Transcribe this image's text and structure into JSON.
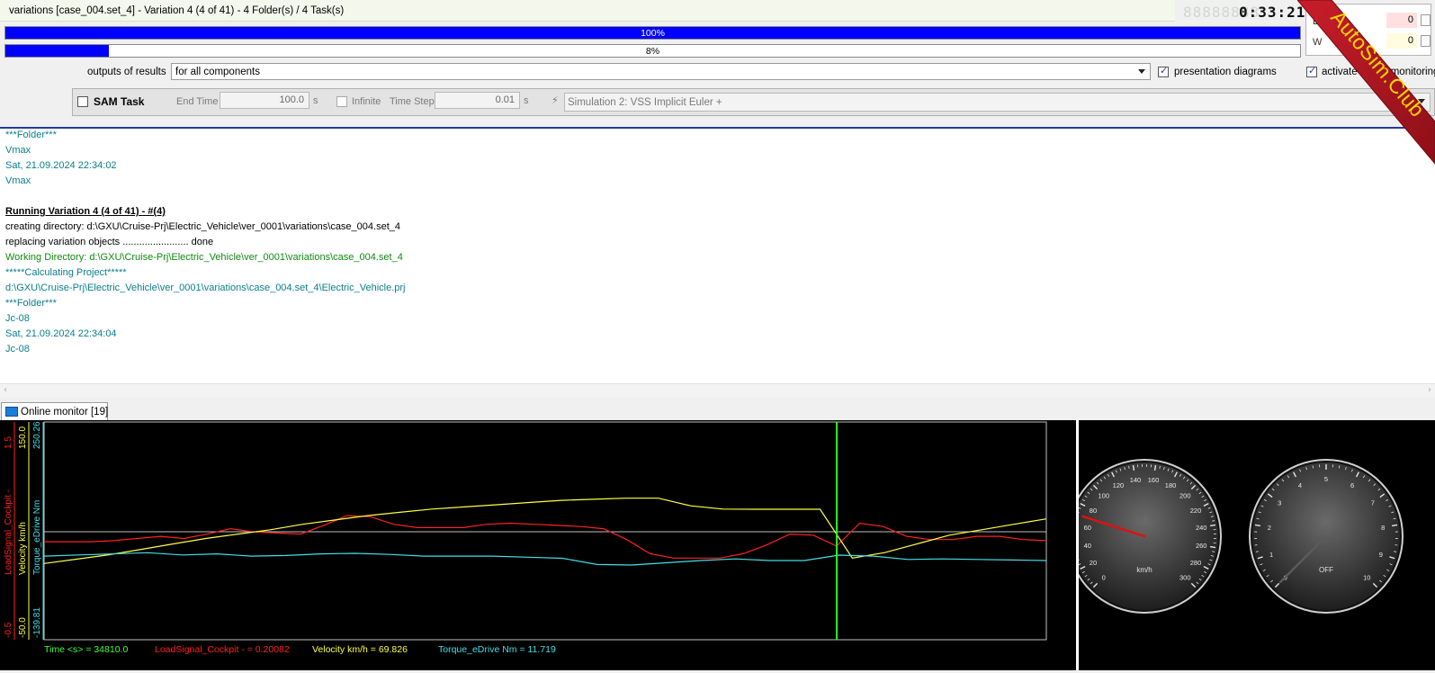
{
  "title": "variations [case_004.set_4] - Variation 4 (4 of 41) - 4 Folder(s) / 4 Task(s)",
  "clock": {
    "ghost": "88888888",
    "time": "0:33:21"
  },
  "progress": [
    {
      "label": "100%",
      "fraction": 1.0
    },
    {
      "label": "8%",
      "fraction": 0.08
    }
  ],
  "counters": [
    {
      "label": "E",
      "value": "0",
      "color": "#ffe0e0"
    },
    {
      "label": "W",
      "value": "0",
      "color": "#fffce0"
    }
  ],
  "outputs": {
    "label": "outputs of results",
    "value": "for all components",
    "presentation_diagrams": "presentation diagrams",
    "activate_monitoring": "activate online monitoring"
  },
  "sam": {
    "title": "SAM Task",
    "end_time_label": "End Time",
    "end_time": "100.0",
    "unit": "s",
    "infinite_label": "Infinite",
    "time_step_label": "Time Step",
    "time_step": "0.01",
    "simulation": "Simulation 2: VSS Implicit Euler +"
  },
  "log": [
    {
      "text": "***Folder***",
      "style": "teal"
    },
    {
      "text": "Vmax",
      "style": "teal"
    },
    {
      "text": "Sat, 21.09.2024 22:34:02",
      "style": "teal"
    },
    {
      "text": "Vmax",
      "style": "teal"
    },
    {
      "text": "",
      "style": "teal"
    },
    {
      "text": "Running Variation 4 (4 of 41) - #(4)",
      "style": "header"
    },
    {
      "text": "creating directory: d:\\GXU\\Cruise-Prj\\Electric_Vehicle\\ver_0001\\variations\\case_004.set_4",
      "style": "black"
    },
    {
      "text": "replacing variation objects ........................ done",
      "style": "black"
    },
    {
      "text": "Working Directory: d:\\GXU\\Cruise-Prj\\Electric_Vehicle\\ver_0001\\variations\\case_004.set_4",
      "style": "green"
    },
    {
      "text": "*****Calculating Project*****",
      "style": "teal"
    },
    {
      "text": "d:\\GXU\\Cruise-Prj\\Electric_Vehicle\\ver_0001\\variations\\case_004.set_4\\Electric_Vehicle.prj",
      "style": "teal"
    },
    {
      "text": "***Folder***",
      "style": "teal"
    },
    {
      "text": "Jc-08",
      "style": "teal"
    },
    {
      "text": "Sat, 21.09.2024 22:34:04",
      "style": "teal"
    },
    {
      "text": "Jc-08",
      "style": "teal"
    }
  ],
  "monitor": {
    "tab_label": "Online monitor [19]",
    "axes": [
      {
        "name": "LoadSignal_Cockpit -",
        "max": "1.5",
        "min": "-0.5",
        "color": "#ff2020"
      },
      {
        "name": "Velocity km/h",
        "max": "150.0",
        "min": "-50.0",
        "color": "#ffff40"
      },
      {
        "name": "Torque_eDrive Nm",
        "max": "250.26",
        "min": "-139.81",
        "color": "#40e0e8"
      }
    ],
    "readouts": [
      {
        "text": "Time <s> = 34810.0",
        "color": "#40ff40"
      },
      {
        "text": "LoadSignal_Cockpit - = 0.20082",
        "color": "#ff2020"
      },
      {
        "text": "Velocity km/h = 69.826",
        "color": "#ffff40"
      },
      {
        "text": "Torque_eDrive Nm = 11.719",
        "color": "#40e0e8"
      }
    ],
    "speedometer": {
      "unit": "km/h",
      "ticks": [
        "0",
        "20",
        "40",
        "60",
        "80",
        "100",
        "120",
        "140",
        "160",
        "180",
        "200",
        "220",
        "240",
        "260",
        "280",
        "300"
      ],
      "value": 69.826
    },
    "tachometer": {
      "label": "OFF",
      "ticks": [
        "0",
        "1",
        "2",
        "3",
        "4",
        "5",
        "6",
        "7",
        "8",
        "9",
        "10"
      ],
      "value": 0
    }
  },
  "chart_data": {
    "type": "line",
    "x_label": "Time <s>",
    "series": [
      {
        "name": "LoadSignal_Cockpit -",
        "color": "#ff2020",
        "values": [
          0.4,
          0.4,
          0.4,
          0.41,
          0.43,
          0.45,
          0.43,
          0.47,
          0.52,
          0.49,
          0.48,
          0.47,
          0.55,
          0.64,
          0.63,
          0.56,
          0.53,
          0.53,
          0.53,
          0.56,
          0.57,
          0.56,
          0.55,
          0.54,
          0.52,
          0.42,
          0.29,
          0.25,
          0.25,
          0.25,
          0.29,
          0.37,
          0.47,
          0.46,
          0.36,
          0.57,
          0.54,
          0.45,
          0.42,
          0.42,
          0.45,
          0.45,
          0.42,
          0.41
        ]
      },
      {
        "name": "Velocity km/h",
        "color": "#ffff40",
        "values": [
          20,
          24,
          28,
          33,
          38,
          43,
          47,
          51,
          56,
          60,
          64,
          67,
          70,
          72,
          74,
          76,
          78,
          79,
          80,
          80,
          73,
          70,
          69.8,
          69.8,
          69.8,
          25,
          30,
          38,
          46,
          51,
          56,
          61
        ]
      },
      {
        "name": "Torque_eDrive Nm",
        "color": "#40e0e8",
        "values": [
          10,
          12,
          14,
          16,
          12,
          14,
          10,
          11,
          14,
          15,
          13,
          10,
          10,
          10,
          8,
          6,
          -5,
          -6,
          -2,
          2,
          5,
          2,
          2,
          11.7,
          10,
          4,
          5,
          4,
          3,
          2
        ]
      }
    ]
  }
}
